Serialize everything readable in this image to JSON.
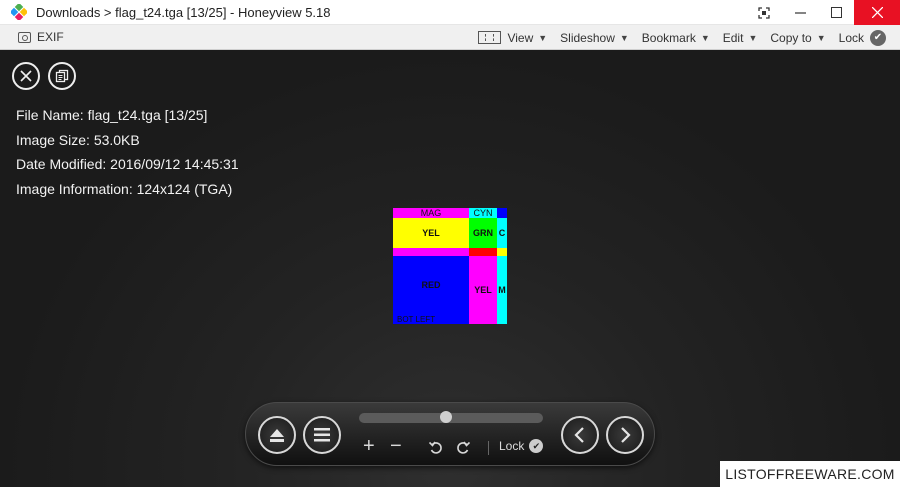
{
  "titlebar": {
    "title": "Downloads > flag_t24.tga [13/25] - Honeyview 5.18"
  },
  "toolbar": {
    "exif_label": "EXIF",
    "view_label": "View",
    "slideshow_label": "Slideshow",
    "bookmark_label": "Bookmark",
    "edit_label": "Edit",
    "copy_to_label": "Copy to",
    "lock_label": "Lock"
  },
  "info": {
    "file_name": "File Name: flag_t24.tga [13/25]",
    "image_size": "Image Size: 53.0KB",
    "date_modified": "Date Modified: 2016/09/12 14:45:31",
    "image_information": "Image Information: 124x124 (TGA)"
  },
  "image": {
    "labels": {
      "mag": "MAG",
      "cyn": "CYN",
      "yel_top": "YEL",
      "grn": "GRN",
      "c": "C",
      "red": "RED",
      "yel_bottom": "YEL",
      "m": "M",
      "bot_left": "BOT LEFT"
    }
  },
  "controls": {
    "plus": "+",
    "minus": "−",
    "lock_label": "Lock",
    "slider_value": 0.47
  },
  "watermark": "LISTOFFREEWARE.COM",
  "colors": {
    "close_red": "#e81123",
    "viewer_bg": "#1b1b1b"
  }
}
